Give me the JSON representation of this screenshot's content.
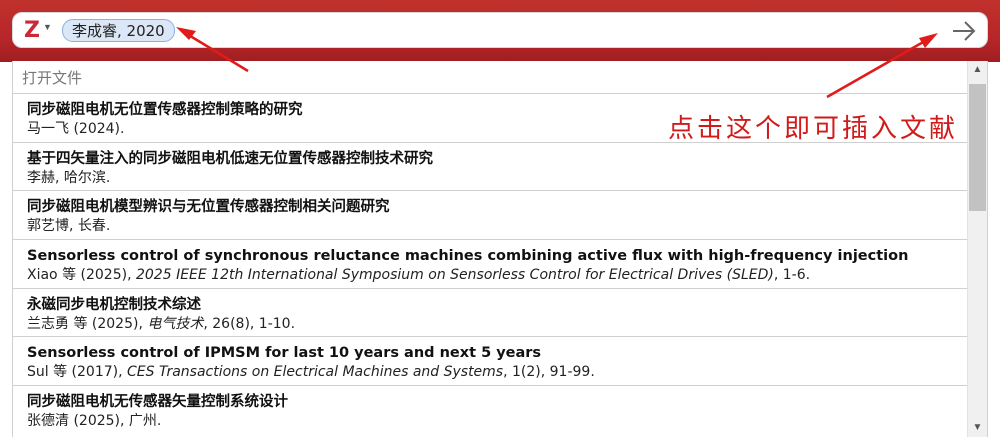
{
  "search": {
    "logo_letter": "Z",
    "citation_bubble": "李成睿, 2020"
  },
  "dropdown": {
    "section_header": "打开文件",
    "items": [
      {
        "title": "同步磁阻电机无位置传感器控制策略的研究",
        "authors": "马一飞 (2024).",
        "journal": "",
        "rest": ""
      },
      {
        "title": "基于四矢量注入的同步磁阻电机低速无位置传感器控制技术研究",
        "authors": "李赫, 哈尔滨.",
        "journal": "",
        "rest": ""
      },
      {
        "title": "同步磁阻电机模型辨识与无位置传感器控制相关问题研究",
        "authors": "郭艺博, 长春.",
        "journal": "",
        "rest": ""
      },
      {
        "title": "Sensorless control of synchronous reluctance machines combining active flux with high-frequency injection",
        "authors": "Xiao 等 (2025), ",
        "journal": "2025 IEEE 12th International Symposium on Sensorless Control for Electrical Drives (SLED)",
        "rest": ", 1-6."
      },
      {
        "title": "永磁同步电机控制技术综述",
        "authors": "兰志勇 等 (2025), ",
        "journal": "电气技术",
        "rest": ", 26(8), 1-10."
      },
      {
        "title": "Sensorless control of IPMSM for last 10 years and next 5 years",
        "authors": "Sul 等 (2017), ",
        "journal": "CES Transactions on Electrical Machines and Systems",
        "rest": ", 1(2), 91-99."
      },
      {
        "title": "同步磁阻电机无传感器矢量控制系统设计",
        "authors": "张德清 (2025), 广州.",
        "journal": "",
        "rest": ""
      }
    ]
  },
  "annotation": {
    "text": "点击这个即可插入文献",
    "color": "#d11a1a"
  },
  "colors": {
    "topbar": "#b8262a",
    "bubble_bg": "#dbe6f6",
    "bubble_border": "#8db0de"
  }
}
